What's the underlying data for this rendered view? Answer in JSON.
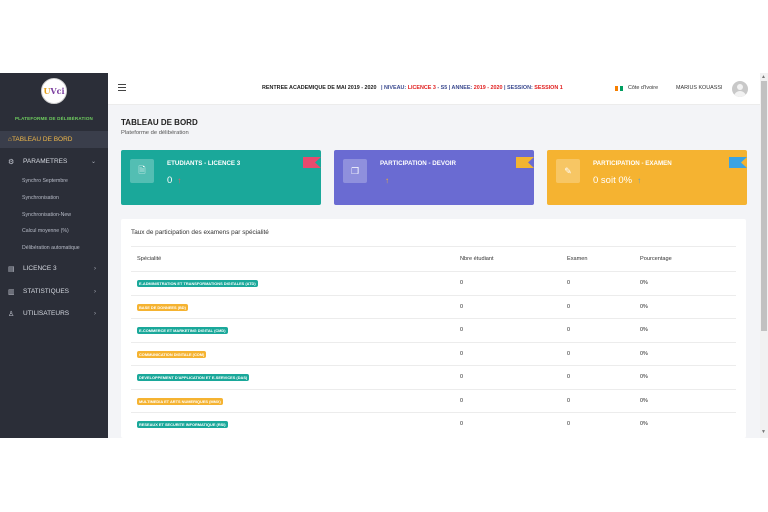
{
  "sidebar": {
    "logo_text_a": "U",
    "logo_text_b": "Vci",
    "platform_label": "PLATEFORME DE DÉLIBÉRATION",
    "dashboard": "TABLEAU DE BORD",
    "parametres": "PARAMETRES",
    "sub_items": [
      "Synchro Septembre",
      "Synchronisation",
      "Synchronisation-New",
      "Calcul moyenne (%)",
      "Délibération automatique"
    ],
    "licence": "LICENCE 3",
    "statistiques": "STATISTIQUES",
    "utilisateurs": "UTILISATEURS"
  },
  "topbar": {
    "rentree": "RENTREE ACADEMIQUE DE MAI 2019 - 2020",
    "niveau_label": "| NIVEAU:",
    "niveau_value": "LICENCE 3",
    "niveau_suffix": " - S5",
    "annee_label": "| ANNEE:",
    "annee_value": "2019 - 2020",
    "session_label": "| SESSION:",
    "session_value": "SESSION 1",
    "country": "Côte d'Ivoire",
    "username": "MARIUS KOUASSI"
  },
  "page": {
    "title": "TABLEAU DE BORD",
    "subtitle": "Plateforme de délibération"
  },
  "cards": [
    {
      "title": "ETUDIANTS - LICENCE 3",
      "value": "0",
      "arrow": "↑",
      "color": "#1aa89a",
      "arrow_color": "#e85a6a",
      "ribbon_color": "#e84a6e",
      "icon": "document-icon"
    },
    {
      "title": "PARTICIPATION - DEVOIR",
      "value": "",
      "arrow": "↑",
      "color": "#6a6bd2",
      "arrow_color": "#f2b431",
      "ribbon_color": "#f2b431",
      "icon": "notes-icon"
    },
    {
      "title": "PARTICIPATION - EXAMEN",
      "value": "0 soit 0%",
      "arrow": "↑",
      "color": "#f5b331",
      "arrow_color": "#4aa3df",
      "ribbon_color": "#3aa3e3",
      "icon": "pen-icon"
    }
  ],
  "table": {
    "title": "Taux de participation des examens par spécialité",
    "headers": [
      "Spécialité",
      "Nbre étudiant",
      "Examen",
      "Pourcentage"
    ],
    "rows": [
      {
        "specialite": "E-ADMINISTRATION ET TRANSFORMATIONS DIGITALES (ATD)",
        "color": "#1aa89a",
        "nbre": "0",
        "examen": "0",
        "pourcentage": "0%"
      },
      {
        "specialite": "BASE DE DONNEES (BD)",
        "color": "#f5b331",
        "nbre": "0",
        "examen": "0",
        "pourcentage": "0%"
      },
      {
        "specialite": "E-COMMERCE ET MARKETING DIGITAL (CMD)",
        "color": "#1aa89a",
        "nbre": "0",
        "examen": "0",
        "pourcentage": "0%"
      },
      {
        "specialite": "COMMUNICATION DIGITALE (COM)",
        "color": "#f5b331",
        "nbre": "0",
        "examen": "0",
        "pourcentage": "0%"
      },
      {
        "specialite": "DEVELOPPEMENT D'APPLICATION ET E-SERVICES (DAS)",
        "color": "#1aa89a",
        "nbre": "0",
        "examen": "0",
        "pourcentage": "0%"
      },
      {
        "specialite": "MULTIMEDIA ET ARTS NUMERIQUES (MMX)",
        "color": "#f5b331",
        "nbre": "0",
        "examen": "0",
        "pourcentage": "0%"
      },
      {
        "specialite": "RESEAUX ET SECURITE INFORMATIQUE (RSI)",
        "color": "#1aa89a",
        "nbre": "0",
        "examen": "0",
        "pourcentage": "0%"
      }
    ]
  },
  "colors": {
    "sidebar_bg": "#2b2e38",
    "accent": "#f0b84a",
    "teal": "#1aa89a",
    "purple": "#6a6bd2",
    "amber": "#f5b331",
    "red": "#e02020"
  }
}
